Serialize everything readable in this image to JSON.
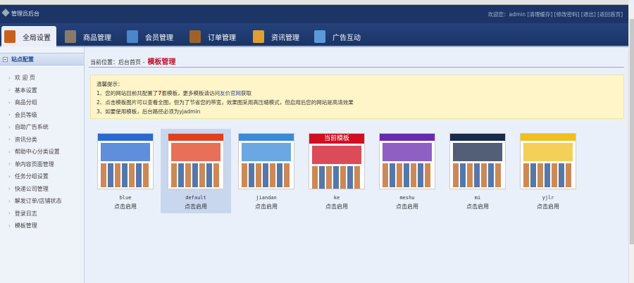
{
  "header": {
    "title": "管理员后台",
    "welcome": "欢迎您：admin",
    "links": [
      "[清理缓存]",
      "[修改密码]",
      "[退出]",
      "[返回首页]"
    ]
  },
  "nav": {
    "tabs": [
      {
        "label": "全局设置",
        "color": "#c8601e"
      },
      {
        "label": "商品管理",
        "color": "#8a7a6a"
      },
      {
        "label": "会员管理",
        "color": "#4a86c8"
      },
      {
        "label": "订单管理",
        "color": "#a0622a"
      },
      {
        "label": "资讯管理",
        "color": "#e0a030"
      },
      {
        "label": "广告互动",
        "color": "#5a9ad8"
      }
    ]
  },
  "sidebar": {
    "title": "站点配置",
    "items": [
      "欢 迎 页",
      "基本设置",
      "商品分组",
      "会员等级",
      "自助广告系统",
      "资讯分类",
      "帮助中心分类设置",
      "单内容页面管理",
      "任务分组设置",
      "快递公司管理",
      "解发订单/店铺状态",
      "登录日志",
      "模板管理"
    ]
  },
  "breadcrumb": {
    "label": "当前位置：后台首页 -",
    "current": "模板管理"
  },
  "tips": {
    "title": "温馨提示：",
    "line1_a": "1、您的网站目前共配置了",
    "count": "7",
    "line1_b": "套模板，更多模板请访问",
    "link": "友价官网",
    "line1_c": "获取",
    "line2": "2、点击模板图片可以查看全图，但为了节省您的带宽，效果图采用高压缩模式，但启用后您的网站是高清效果",
    "line3": "3、如要使用模板，后台路径必须为yjadmin"
  },
  "templates": [
    {
      "name": "blue",
      "action": "点击启用",
      "color": "#2a6ad0"
    },
    {
      "name": "default",
      "action": "点击启用",
      "color": "#e04020",
      "selected": true
    },
    {
      "name": "jiandan",
      "action": "点击启用",
      "color": "#3a8ad8"
    },
    {
      "name": "ke",
      "action": "点击启用",
      "color": "#d01020",
      "banner": "当前模板"
    },
    {
      "name": "meshu",
      "action": "点击启用",
      "color": "#6a2ab0"
    },
    {
      "name": "mi",
      "action": "点击启用",
      "color": "#1a2a4a"
    },
    {
      "name": "yjlr",
      "action": "点击启用",
      "color": "#f0c020"
    }
  ]
}
